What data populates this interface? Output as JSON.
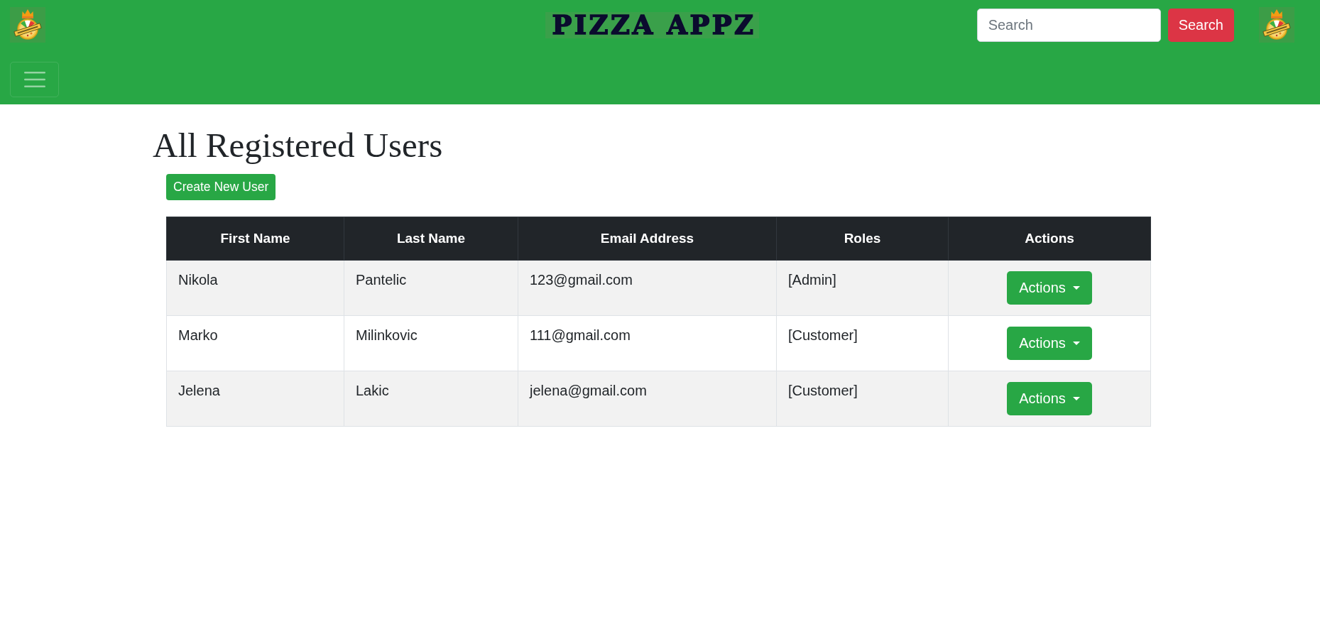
{
  "navbar": {
    "brand": "PIZZA APPZ",
    "search": {
      "placeholder": "Search"
    },
    "search_button": "Search"
  },
  "page": {
    "heading": "All Registered Users",
    "create_button": "Create New User"
  },
  "table": {
    "columns": [
      "First Name",
      "Last Name",
      "Email Address",
      "Roles",
      "Actions"
    ],
    "rows": [
      {
        "cells": [
          "Nikola",
          "Pantelic",
          "123@gmail.com",
          "[Admin]"
        ],
        "action_button": "Actions"
      },
      {
        "cells": [
          "Marko",
          "Milinkovic",
          "111@gmail.com",
          "[Customer]"
        ],
        "action_button": "Actions"
      },
      {
        "cells": [
          "Jelena",
          "Lakic",
          "jelena@gmail.com",
          "[Customer]"
        ],
        "action_button": "Actions"
      }
    ]
  }
}
